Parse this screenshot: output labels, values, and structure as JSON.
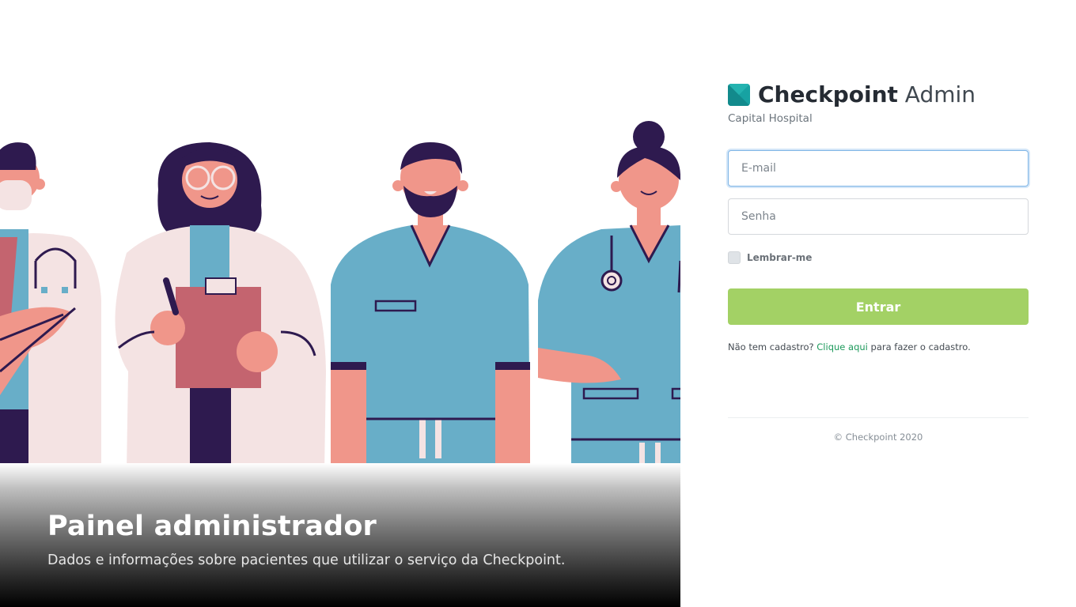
{
  "hero": {
    "title": "Painel administrador",
    "subtitle": "Dados e informações sobre pacientes que utilizar o serviço da Checkpoint."
  },
  "brand": {
    "name_bold": "Checkpoint",
    "name_light": "Admin",
    "hospital": "Capital Hospital",
    "logo_color": "#17a2a2"
  },
  "form": {
    "email_placeholder": "E-mail",
    "password_placeholder": "Senha",
    "remember_label": "Lembrar-me",
    "submit_label": "Entrar",
    "signup_prefix": "Não tem cadastro?",
    "signup_link": "Clique aqui",
    "signup_suffix": "para fazer o cadastro."
  },
  "footer": {
    "copyright": "© Checkpoint 2020"
  },
  "colors": {
    "button": "#a3d165",
    "link": "#1e9a5c",
    "scrubs": "#68aec8",
    "skin": "#f0968a",
    "hair": "#2e1a4f",
    "coat": "#f4e3e3"
  }
}
